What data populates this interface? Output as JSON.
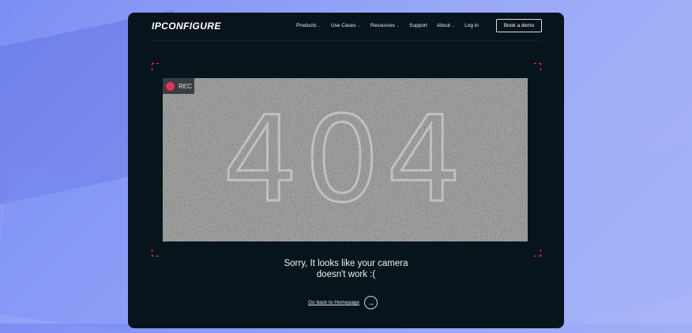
{
  "brand": {
    "logo_text": "IPCONFIGURE"
  },
  "nav": {
    "items": [
      {
        "label": "Products",
        "has_caret": true
      },
      {
        "label": "Use Cases",
        "has_caret": true
      },
      {
        "label": "Resources",
        "has_caret": true
      },
      {
        "label": "Support",
        "has_caret": false
      },
      {
        "label": "About",
        "has_caret": true
      },
      {
        "label": "Log in",
        "has_caret": false
      }
    ],
    "caret_symbol": "⌄",
    "cta_label": "Book a demo"
  },
  "camera": {
    "rec_label": "REC",
    "error_code": "404"
  },
  "message": {
    "line1": "Sorry, It looks like your camera",
    "line2": "doesn't work :("
  },
  "back": {
    "label": "Go back to Homepage",
    "icon_glyph": "→"
  },
  "colors": {
    "window_bg": "#08141c",
    "accent_red": "#e8305a",
    "page_gradient_start": "#7d8ef3",
    "page_gradient_end": "#aab6f8"
  }
}
